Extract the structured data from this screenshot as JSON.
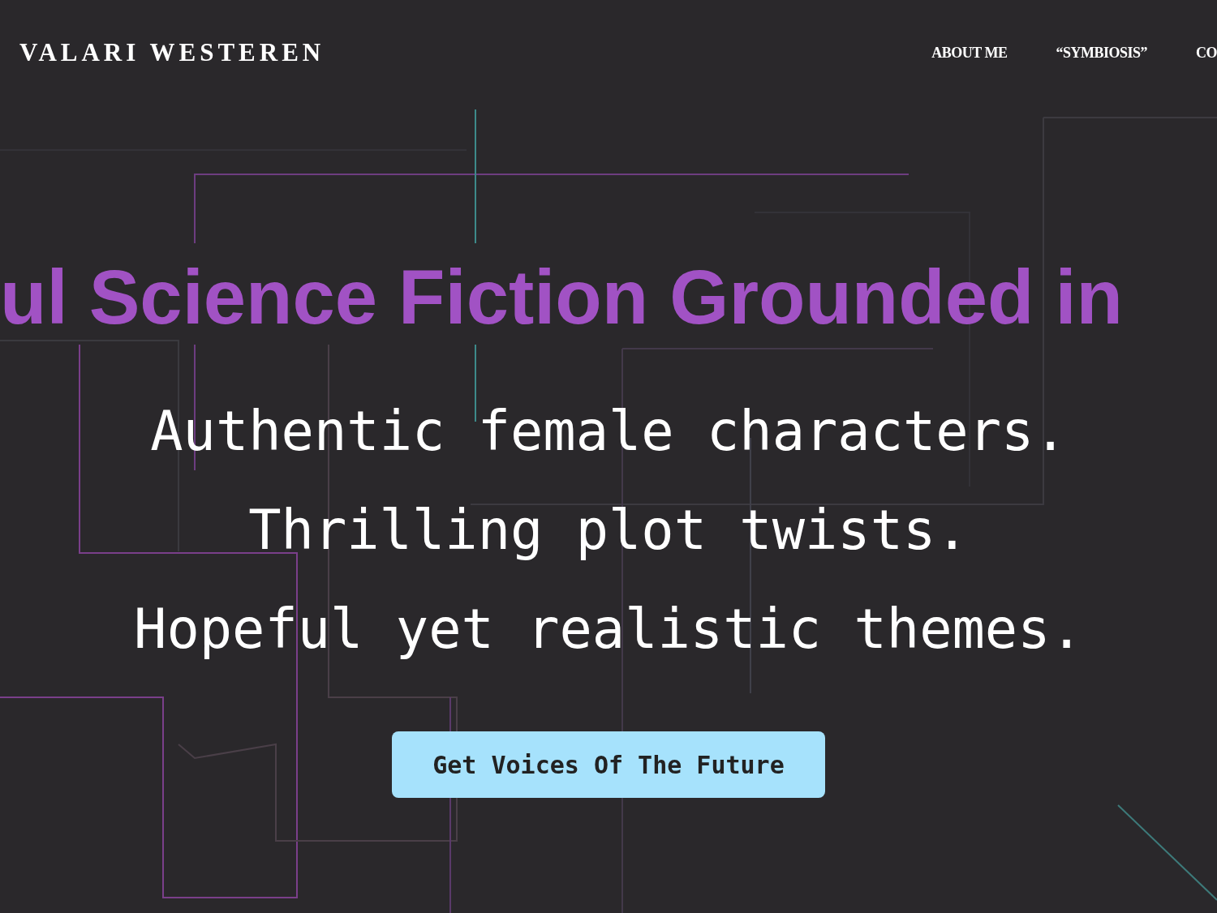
{
  "header": {
    "logo": "VALARI WESTEREN",
    "nav": [
      {
        "label": "ABOUT ME"
      },
      {
        "label": "“SYMBIOSIS”"
      },
      {
        "label": "CO"
      }
    ]
  },
  "hero": {
    "headline": "ul Science Fiction Grounded in",
    "lines": [
      "Authentic female characters.",
      "Thrilling plot twists.",
      "Hopeful yet realistic themes."
    ],
    "button": "Get Voices Of The Future"
  }
}
